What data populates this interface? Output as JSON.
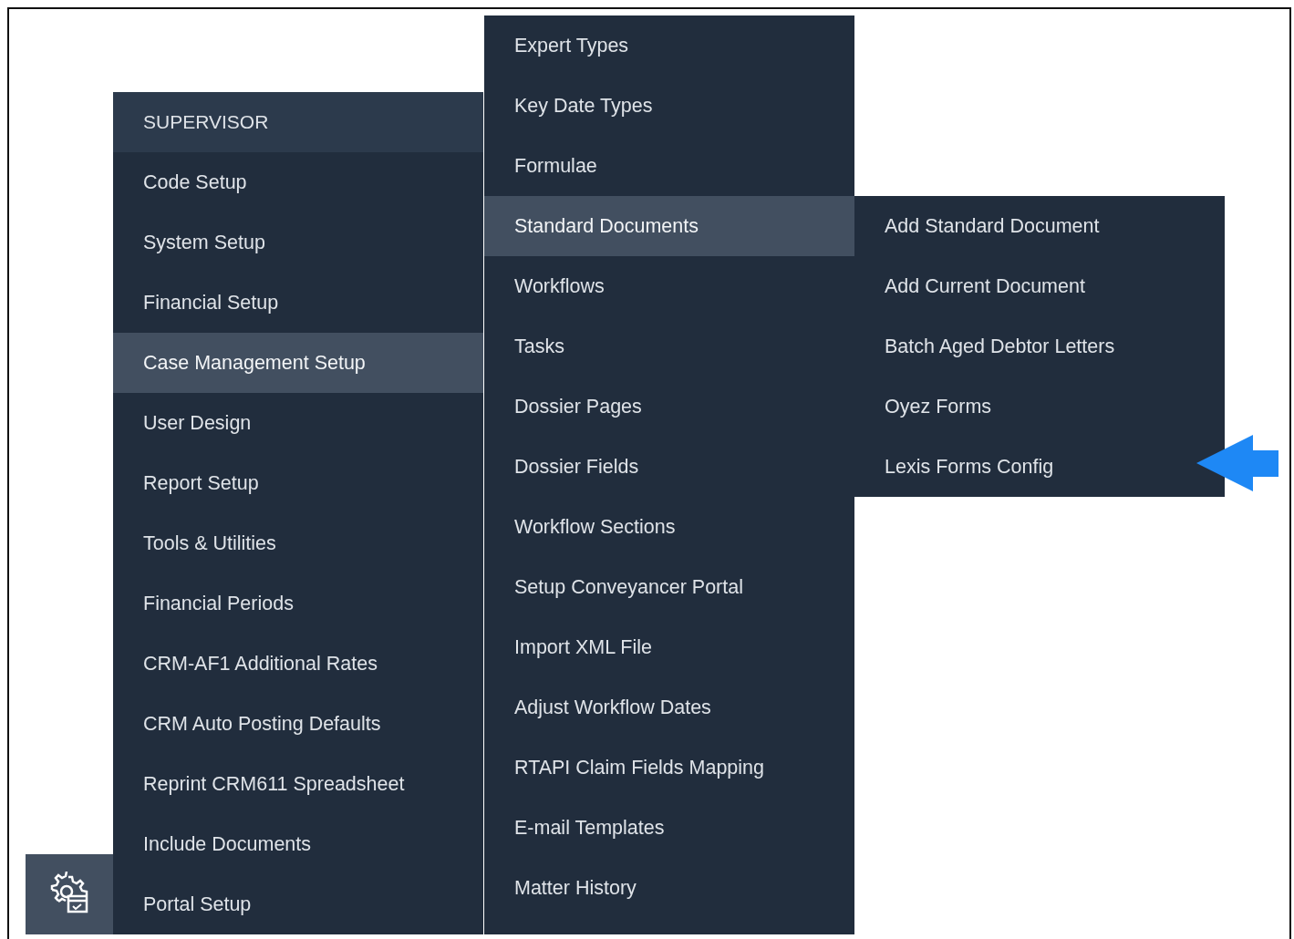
{
  "supervisor_menu": {
    "title": "SUPERVISOR",
    "items": [
      {
        "label": "Code Setup",
        "selected": false
      },
      {
        "label": "System Setup",
        "selected": false
      },
      {
        "label": "Financial Setup",
        "selected": false
      },
      {
        "label": "Case Management Setup",
        "selected": true
      },
      {
        "label": "User Design",
        "selected": false
      },
      {
        "label": "Report Setup",
        "selected": false
      },
      {
        "label": "Tools & Utilities",
        "selected": false
      },
      {
        "label": "Financial Periods",
        "selected": false
      },
      {
        "label": "CRM-AF1 Additional Rates",
        "selected": false
      },
      {
        "label": "CRM Auto Posting Defaults",
        "selected": false
      },
      {
        "label": "Reprint CRM611 Spreadsheet",
        "selected": false
      },
      {
        "label": "Include Documents",
        "selected": false
      },
      {
        "label": "Portal Setup",
        "selected": false
      }
    ]
  },
  "case_management_menu": {
    "items": [
      {
        "label": "Expert Types",
        "selected": false
      },
      {
        "label": "Key Date Types",
        "selected": false
      },
      {
        "label": "Formulae",
        "selected": false
      },
      {
        "label": "Standard Documents",
        "selected": true
      },
      {
        "label": "Workflows",
        "selected": false
      },
      {
        "label": "Tasks",
        "selected": false
      },
      {
        "label": "Dossier Pages",
        "selected": false
      },
      {
        "label": "Dossier Fields",
        "selected": false
      },
      {
        "label": "Workflow Sections",
        "selected": false
      },
      {
        "label": "Setup Conveyancer Portal",
        "selected": false
      },
      {
        "label": "Import XML File",
        "selected": false
      },
      {
        "label": "Adjust Workflow Dates",
        "selected": false
      },
      {
        "label": "RTAPI Claim Fields Mapping",
        "selected": false
      },
      {
        "label": "E-mail Templates",
        "selected": false
      },
      {
        "label": "Matter History",
        "selected": false
      }
    ]
  },
  "standard_documents_menu": {
    "items": [
      {
        "label": "Add Standard Document",
        "selected": false
      },
      {
        "label": "Add Current Document",
        "selected": false
      },
      {
        "label": "Batch Aged Debtor Letters",
        "selected": false
      },
      {
        "label": "Oyez Forms",
        "selected": false
      },
      {
        "label": "Lexis Forms Config",
        "selected": false
      }
    ]
  }
}
